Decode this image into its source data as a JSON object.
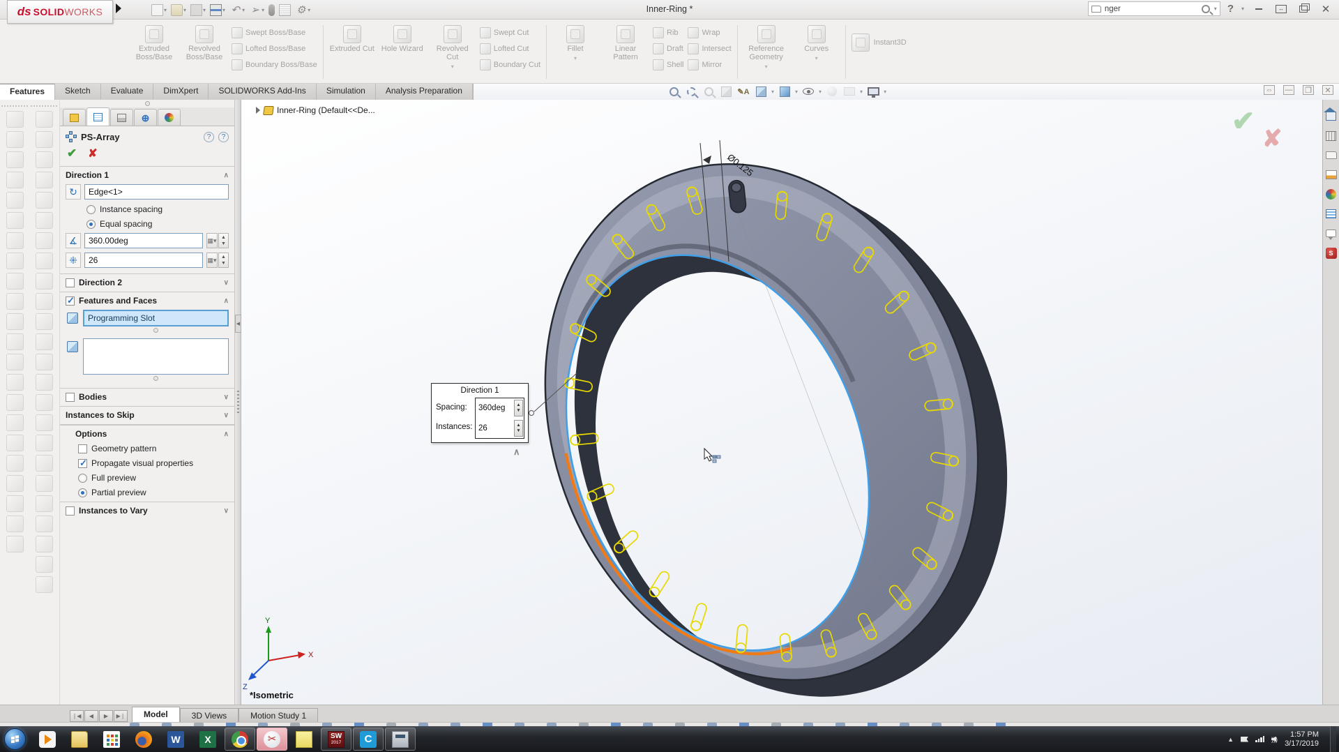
{
  "titlebar": {
    "logo_ds": "ds",
    "logo_solid": "SOLID",
    "logo_works": "WORKS",
    "title": "Inner-Ring *",
    "search_value": "nger",
    "help_label": "?"
  },
  "quick_access_icons": [
    "new-document",
    "open",
    "save",
    "print",
    "undo",
    "select",
    "rebuild",
    "file-properties",
    "options"
  ],
  "ribbon": {
    "groups": [
      {
        "big": [
          {
            "label": "Extruded Boss/Base"
          },
          {
            "label": "Revolved Boss/Base"
          }
        ],
        "small": [
          {
            "label": "Swept Boss/Base"
          },
          {
            "label": "Lofted Boss/Base"
          },
          {
            "label": "Boundary Boss/Base"
          }
        ]
      },
      {
        "big": [
          {
            "label": "Extruded Cut"
          },
          {
            "label": "Hole Wizard"
          },
          {
            "label": "Revolved Cut"
          }
        ],
        "small": [
          {
            "label": "Swept Cut"
          },
          {
            "label": "Lofted Cut"
          },
          {
            "label": "Boundary Cut"
          }
        ]
      },
      {
        "big": [
          {
            "label": "Fillet"
          },
          {
            "label": "Linear Pattern"
          }
        ],
        "small": [
          {
            "label": "Rib"
          },
          {
            "label": "Draft"
          },
          {
            "label": "Shell"
          },
          {
            "label": "Wrap"
          },
          {
            "label": "Intersect"
          },
          {
            "label": "Mirror"
          }
        ]
      },
      {
        "big": [
          {
            "label": "Reference Geometry"
          },
          {
            "label": "Curves"
          }
        ],
        "small": []
      },
      {
        "big": [
          {
            "label": "Instant3D"
          }
        ],
        "small": []
      }
    ]
  },
  "command_tabs": [
    {
      "label": "Features"
    },
    {
      "label": "Sketch"
    },
    {
      "label": "Evaluate"
    },
    {
      "label": "DimXpert"
    },
    {
      "label": "SOLIDWORKS Add-Ins"
    },
    {
      "label": "Simulation"
    },
    {
      "label": "Analysis Preparation"
    }
  ],
  "headsup_icons": [
    "zoom-to-fit",
    "zoom-to-area",
    "previous-view",
    "section-view",
    "hide-annotations",
    "view-orientation",
    "display-style",
    "hide-show-items",
    "edit-appearance",
    "apply-scene",
    "view-settings"
  ],
  "property_manager": {
    "panel_tabs": [
      "featuremanager-design-tree",
      "propertymanager",
      "configurationmanager",
      "dimxpertmanager",
      "displaymanager"
    ],
    "title": "PS-Array",
    "direction1": {
      "header": "Direction 1",
      "edge_value": "Edge<1>",
      "instance_spacing_label": "Instance spacing",
      "equal_spacing_label": "Equal spacing",
      "angle_value": "360.00deg",
      "instances_value": "26"
    },
    "direction2": {
      "header": "Direction 2"
    },
    "features_and_faces": {
      "header": "Features and Faces",
      "features": [
        "Programming Slot"
      ],
      "faces": []
    },
    "bodies": {
      "header": "Bodies"
    },
    "instances_to_skip": {
      "header": "Instances to Skip"
    },
    "options": {
      "header": "Options",
      "geometry_pattern": "Geometry pattern",
      "propagate": "Propagate visual properties",
      "full_preview": "Full preview",
      "partial_preview": "Partial preview"
    },
    "instances_to_vary": {
      "header": "Instances to Vary"
    }
  },
  "viewport": {
    "feature_tree_root": "Inner-Ring  (Default<<De...",
    "dimension_label": "Ø0.125",
    "view_label": "*Isometric",
    "popup": {
      "title": "Direction 1",
      "spacing_label": "Spacing:",
      "spacing_value": "360deg",
      "instances_label": "Instances:",
      "instances_value": "26"
    },
    "triad": {
      "x": "X",
      "y": "Y",
      "z": "Z"
    },
    "colors": {
      "preview_yellow": "#e8d900",
      "edge_blue": "#3f9fe8",
      "edge_orange": "#f27a15"
    }
  },
  "task_pane_icons": [
    "home",
    "design-library",
    "file-explorer",
    "view-palette",
    "appearances",
    "custom-properties",
    "forum",
    "solidworks-resources"
  ],
  "bottom_bar": {
    "tabs": [
      {
        "label": "Model"
      },
      {
        "label": "3D Views"
      },
      {
        "label": "Motion Study 1"
      }
    ]
  },
  "taskbar": {
    "apps": [
      "start",
      "media-player",
      "file-explorer",
      "app-grid",
      "firefox",
      "word",
      "excel",
      "chrome",
      "snipping-tool",
      "sticky-notes",
      "solidworks-2017",
      "c-app",
      "calculator"
    ],
    "word_letter": "W",
    "excel_letter": "X",
    "c_letter": "C",
    "sw_label": "SW",
    "sw_badge": "2017",
    "time": "1:57 PM",
    "date": "3/17/2019"
  }
}
